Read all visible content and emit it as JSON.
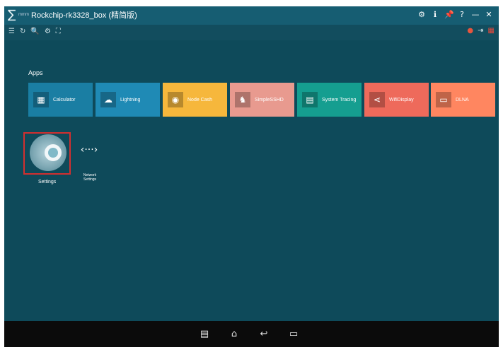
{
  "window": {
    "logo": "∑",
    "brand": "mmm",
    "title": "Rockchip-rk3328_box (精简版)",
    "controls": [
      "⚙",
      "ℹ",
      "📌",
      "?",
      "—",
      "✕"
    ]
  },
  "toolbar": {
    "left": [
      "☰",
      "↻",
      "🔍",
      "⚙",
      "⛶"
    ],
    "right": [
      "●",
      "⇥",
      "▦"
    ]
  },
  "apps_section": {
    "heading": "Apps"
  },
  "apps": [
    {
      "label": "Calculator",
      "icon": "calculator-icon",
      "glyph": "▦",
      "color": "#1a7ea3"
    },
    {
      "label": "Lightning",
      "icon": "lightning-icon",
      "glyph": "☁",
      "color": "#1f8ab5"
    },
    {
      "label": "Node Cash",
      "icon": "node-cash-icon",
      "glyph": "◉",
      "color": "#f6b73c"
    },
    {
      "label": "SimpleSSHD",
      "icon": "sshd-icon",
      "glyph": "♞",
      "color": "#e89a8f"
    },
    {
      "label": "System Tracing",
      "icon": "android-icon",
      "glyph": "▤",
      "color": "#159e90"
    },
    {
      "label": "WifiDisplay",
      "icon": "share-icon",
      "glyph": "⋖",
      "color": "#ee6a5b"
    },
    {
      "label": "DLNA",
      "icon": "dlna-icon",
      "glyph": "▭",
      "color": "#ff8660"
    }
  ],
  "settings": {
    "label": "Settings"
  },
  "network_settings": {
    "glyph": "‹···›",
    "label": "Network Settings"
  },
  "navbar": {
    "buttons": [
      "▤",
      "⌂",
      "↩",
      "▭"
    ]
  }
}
